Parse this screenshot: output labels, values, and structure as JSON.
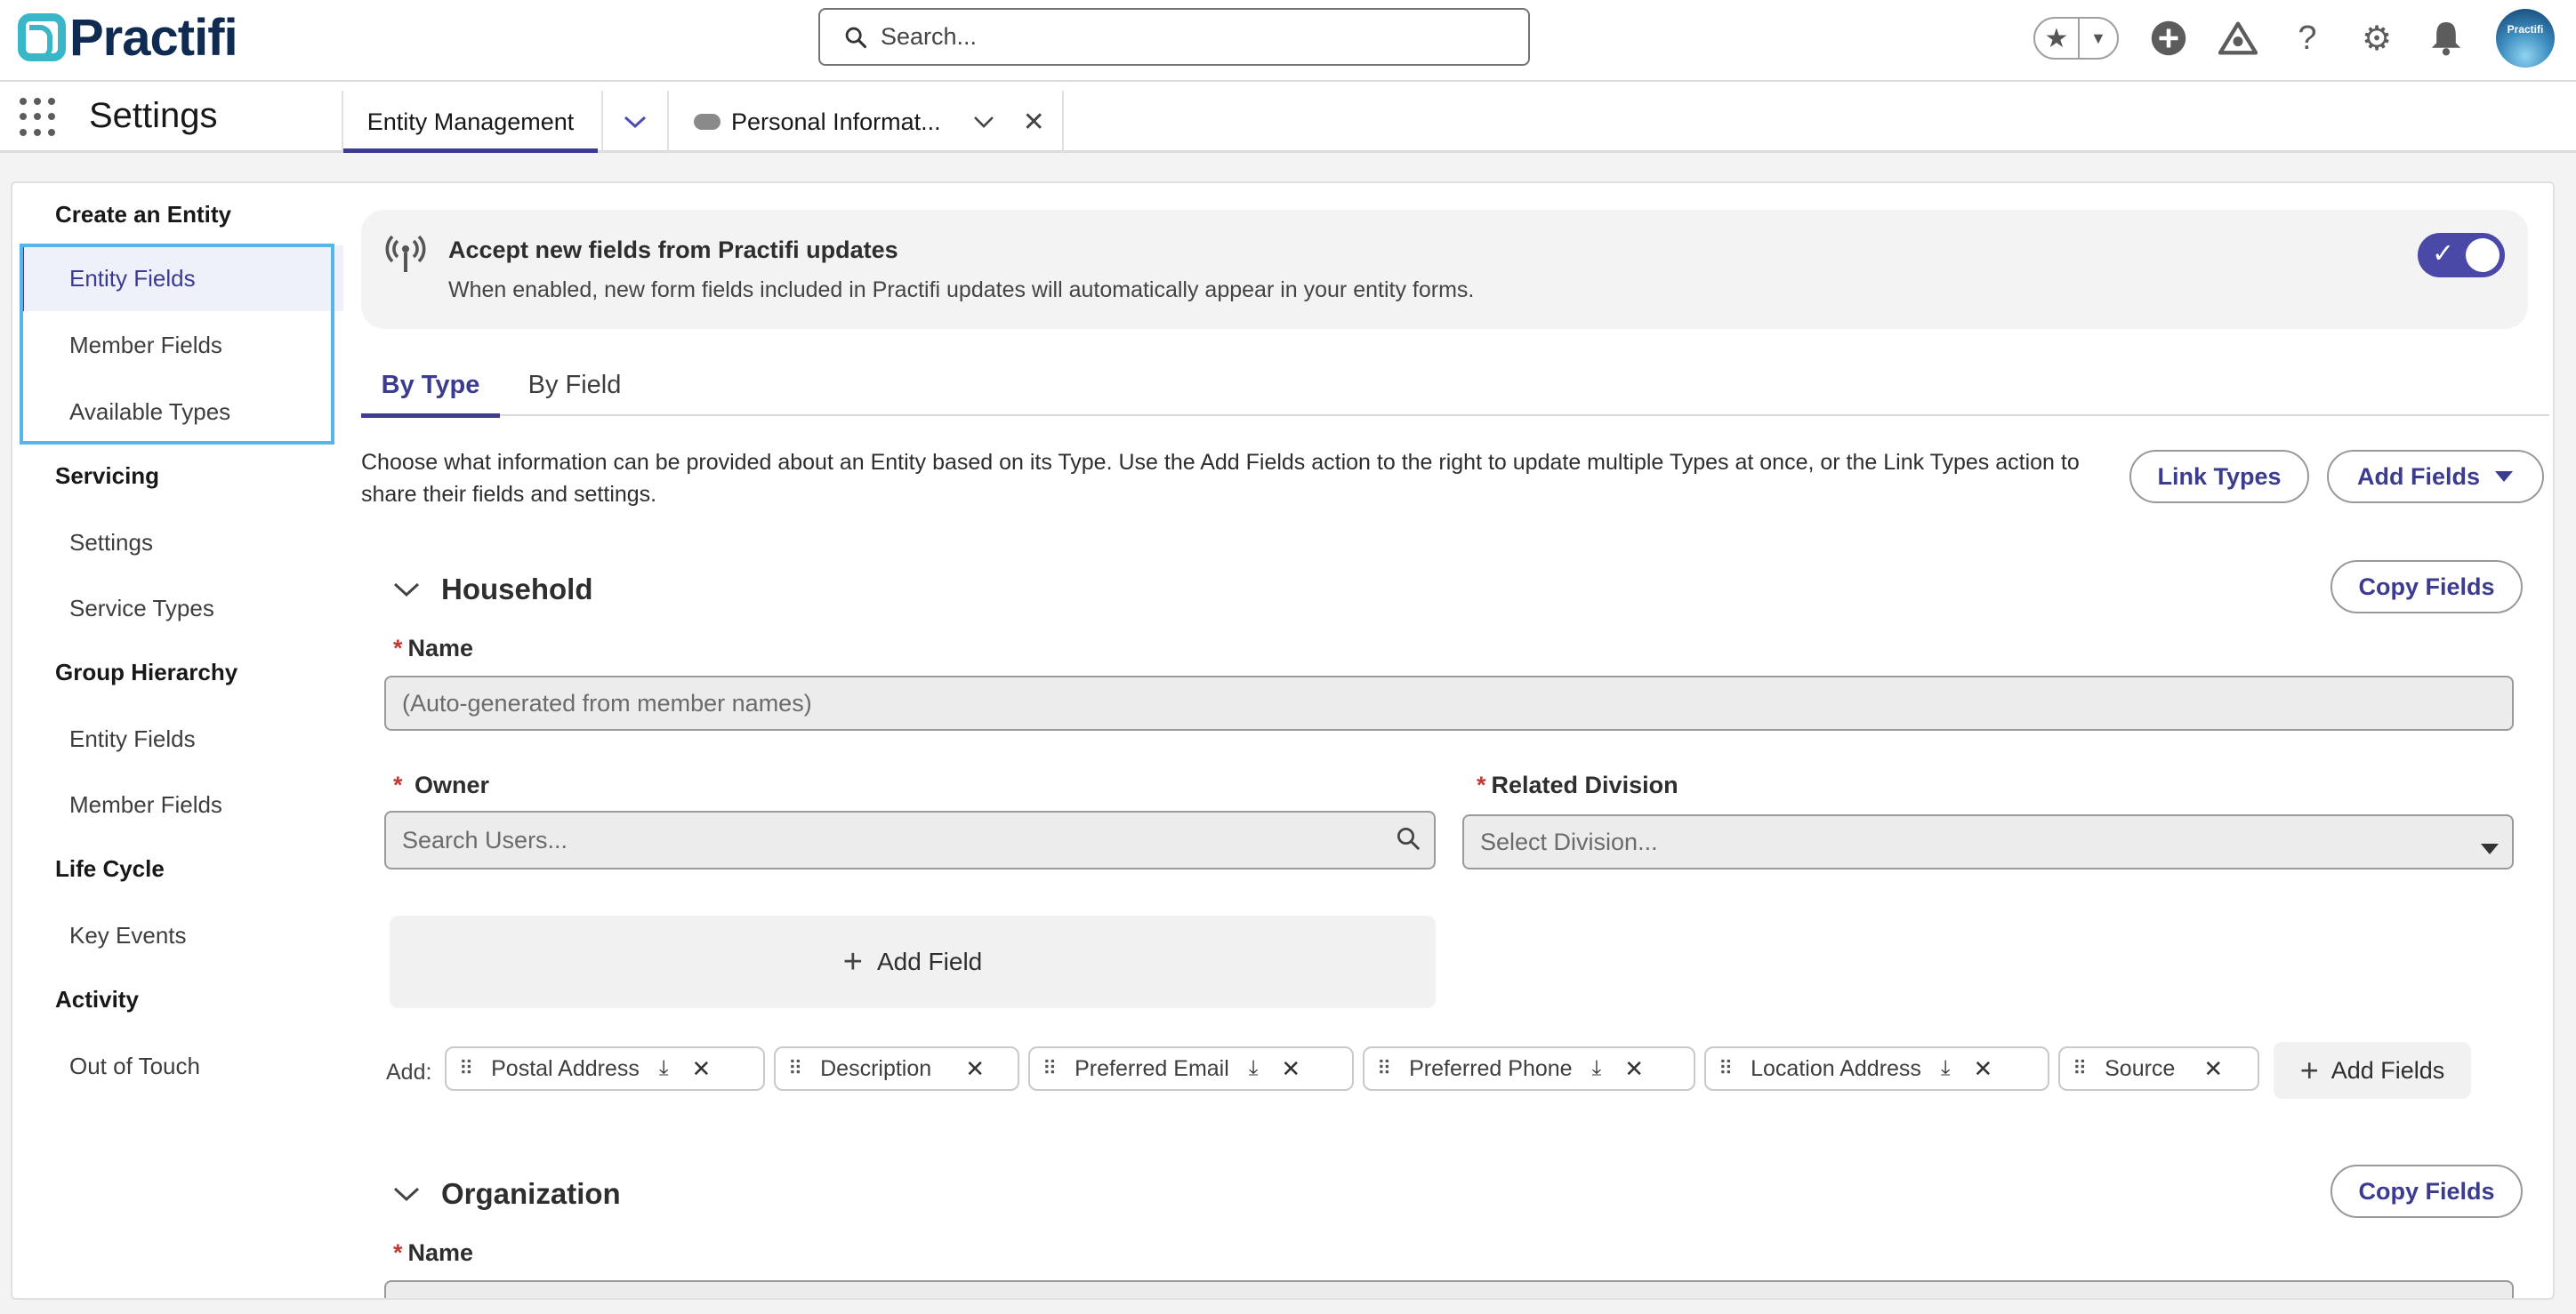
{
  "header": {
    "logo_text": "Practifi",
    "search_placeholder": "Search...",
    "avatar_text": "Practifi"
  },
  "nav": {
    "app_name": "Settings",
    "tabs": [
      {
        "label": "Entity Management",
        "active": true
      },
      {
        "label": "Personal Informat...",
        "active": false
      }
    ]
  },
  "sidebar": {
    "sections": [
      {
        "heading": "Create an Entity",
        "items": [
          "Entity Fields",
          "Member Fields",
          "Available Types"
        ]
      },
      {
        "heading": "Servicing",
        "items": [
          "Settings",
          "Service Types"
        ]
      },
      {
        "heading": "Group Hierarchy",
        "items": [
          "Entity Fields",
          "Member Fields"
        ]
      },
      {
        "heading": "Life Cycle",
        "items": [
          "Key Events"
        ]
      },
      {
        "heading": "Activity",
        "items": [
          "Out of Touch"
        ]
      }
    ],
    "active_item": "Entity Fields"
  },
  "banner": {
    "title": "Accept new fields from Practifi updates",
    "description": "When enabled, new form fields included in Practifi updates will automatically appear in your entity forms.",
    "toggle_on": true
  },
  "subtabs": [
    {
      "label": "By Type",
      "active": true
    },
    {
      "label": "By Field",
      "active": false
    }
  ],
  "intro": {
    "text": "Choose what information can be provided about an Entity based on its Type. Use the Add Fields action to the right to update multiple Types at once, or the Link Types action to share their fields and settings.",
    "link_types_label": "Link Types",
    "add_fields_label": "Add Fields"
  },
  "household": {
    "title": "Household",
    "copy_fields_label": "Copy Fields",
    "name_label": "Name",
    "name_placeholder": "(Auto-generated from member names)",
    "owner_label": "Owner",
    "owner_placeholder": "Search Users...",
    "division_label": "Related Division",
    "division_placeholder": "Select Division...",
    "add_field_label": "Add Field",
    "add_label": "Add:",
    "chips": [
      {
        "label": "Postal Address",
        "download": true
      },
      {
        "label": "Description",
        "download": false
      },
      {
        "label": "Preferred Email",
        "download": true
      },
      {
        "label": "Preferred Phone",
        "download": true
      },
      {
        "label": "Location Address",
        "download": true
      },
      {
        "label": "Source",
        "download": false
      }
    ],
    "add_fields_chip_label": "Add Fields"
  },
  "organization": {
    "title": "Organization",
    "copy_fields_label": "Copy Fields",
    "name_label": "Name"
  },
  "colors": {
    "brand": "#3b3b8f",
    "highlight": "#56b6e9",
    "required": "#c23934"
  }
}
